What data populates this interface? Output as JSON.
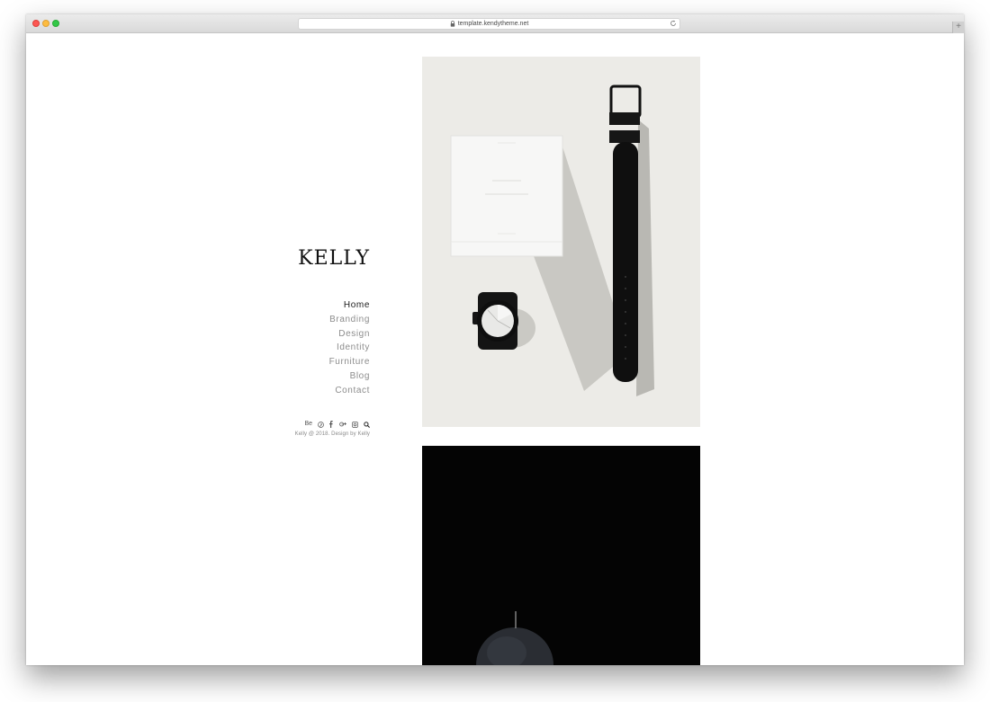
{
  "browser": {
    "url": "template.kendytheme.net",
    "newtab_label": "+"
  },
  "site": {
    "logo": "KELLY",
    "nav": [
      "Home",
      "Branding",
      "Design",
      "Identity",
      "Furniture",
      "Blog",
      "Contact"
    ],
    "active_nav": "Home",
    "social": [
      {
        "icon": "behance-icon",
        "label": "Be"
      },
      {
        "icon": "pinterest-icon"
      },
      {
        "icon": "facebook-icon"
      },
      {
        "icon": "google-plus-icon"
      },
      {
        "icon": "instagram-icon"
      },
      {
        "icon": "search-icon"
      }
    ],
    "copyright": "Kelly @ 2018. Design by Kelly"
  },
  "colors": {
    "active_nav": "#1a1a1a",
    "nav": "#8c8c8c",
    "photo_1_bg": "#ecebe7",
    "photo_2_bg": "#040404"
  },
  "photos": [
    {
      "subject": "watch-box-and-black-watch"
    },
    {
      "subject": "black-candle-on-black"
    }
  ]
}
